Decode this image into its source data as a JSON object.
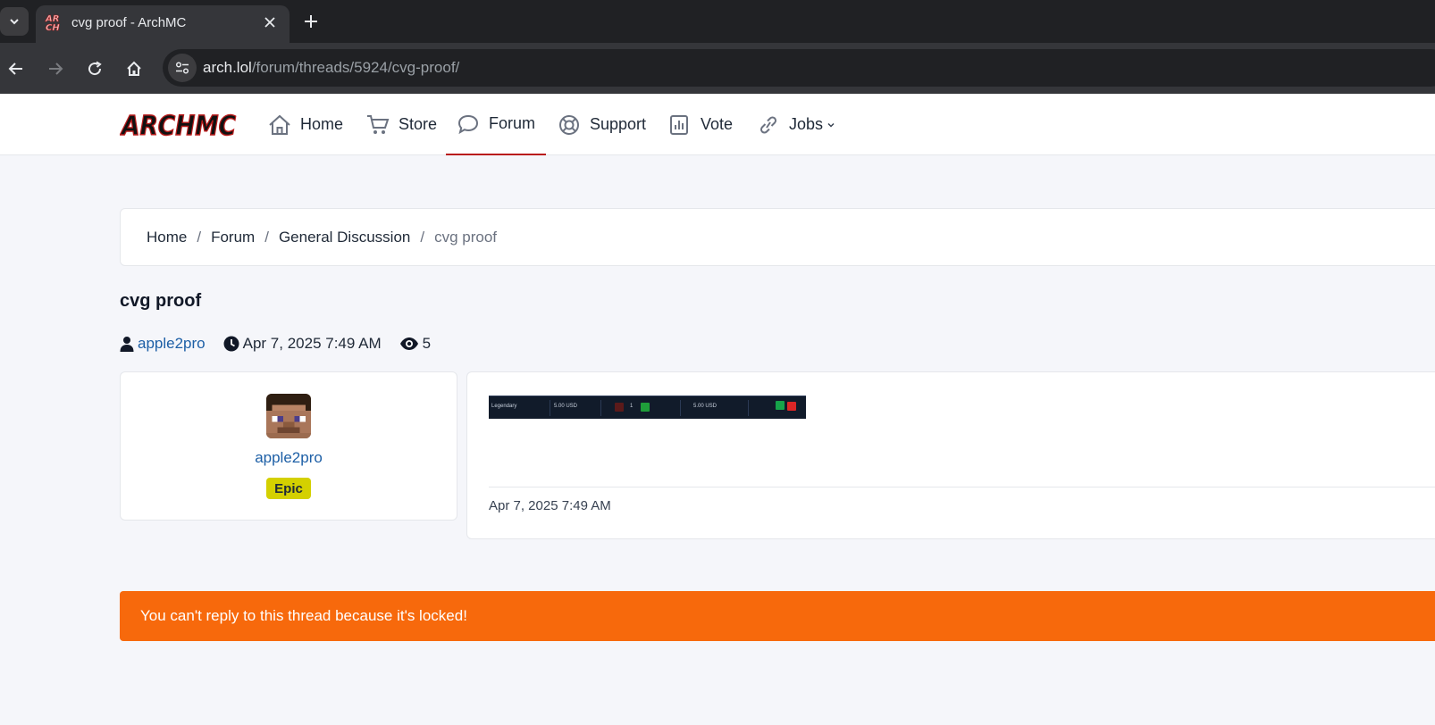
{
  "browser": {
    "tab_title": "cvg proof - ArchMC",
    "url_host": "arch.lol",
    "url_path": "/forum/threads/5924/cvg-proof/"
  },
  "nav": {
    "items": [
      {
        "label": "Home",
        "icon": "home-icon"
      },
      {
        "label": "Store",
        "icon": "cart-icon"
      },
      {
        "label": "Forum",
        "icon": "chat-bubble-icon",
        "active": true
      },
      {
        "label": "Support",
        "icon": "lifebuoy-icon"
      },
      {
        "label": "Vote",
        "icon": "bar-chart-icon"
      },
      {
        "label": "Jobs",
        "icon": "link-icon",
        "dropdown": true
      }
    ]
  },
  "breadcrumb": [
    "Home",
    "Forum",
    "General Discussion",
    "cvg proof"
  ],
  "thread": {
    "title": "cvg proof",
    "author": "apple2pro",
    "date": "Apr 7, 2025 7:49 AM",
    "views": "5"
  },
  "user_card": {
    "username": "apple2pro",
    "rank": "Epic",
    "rank_color": "#d4d000"
  },
  "post": {
    "image_text": {
      "item": "Legendary",
      "price": "5.00 USD",
      "qty": "1",
      "total": "5.00 USD"
    },
    "date": "Apr 7, 2025 7:49 AM"
  },
  "locked_message": "You can't reply to this thread because it's locked!",
  "colors": {
    "accent": "#b91c1c",
    "link": "#1d5fa6",
    "locked_bg": "#f7690c"
  }
}
